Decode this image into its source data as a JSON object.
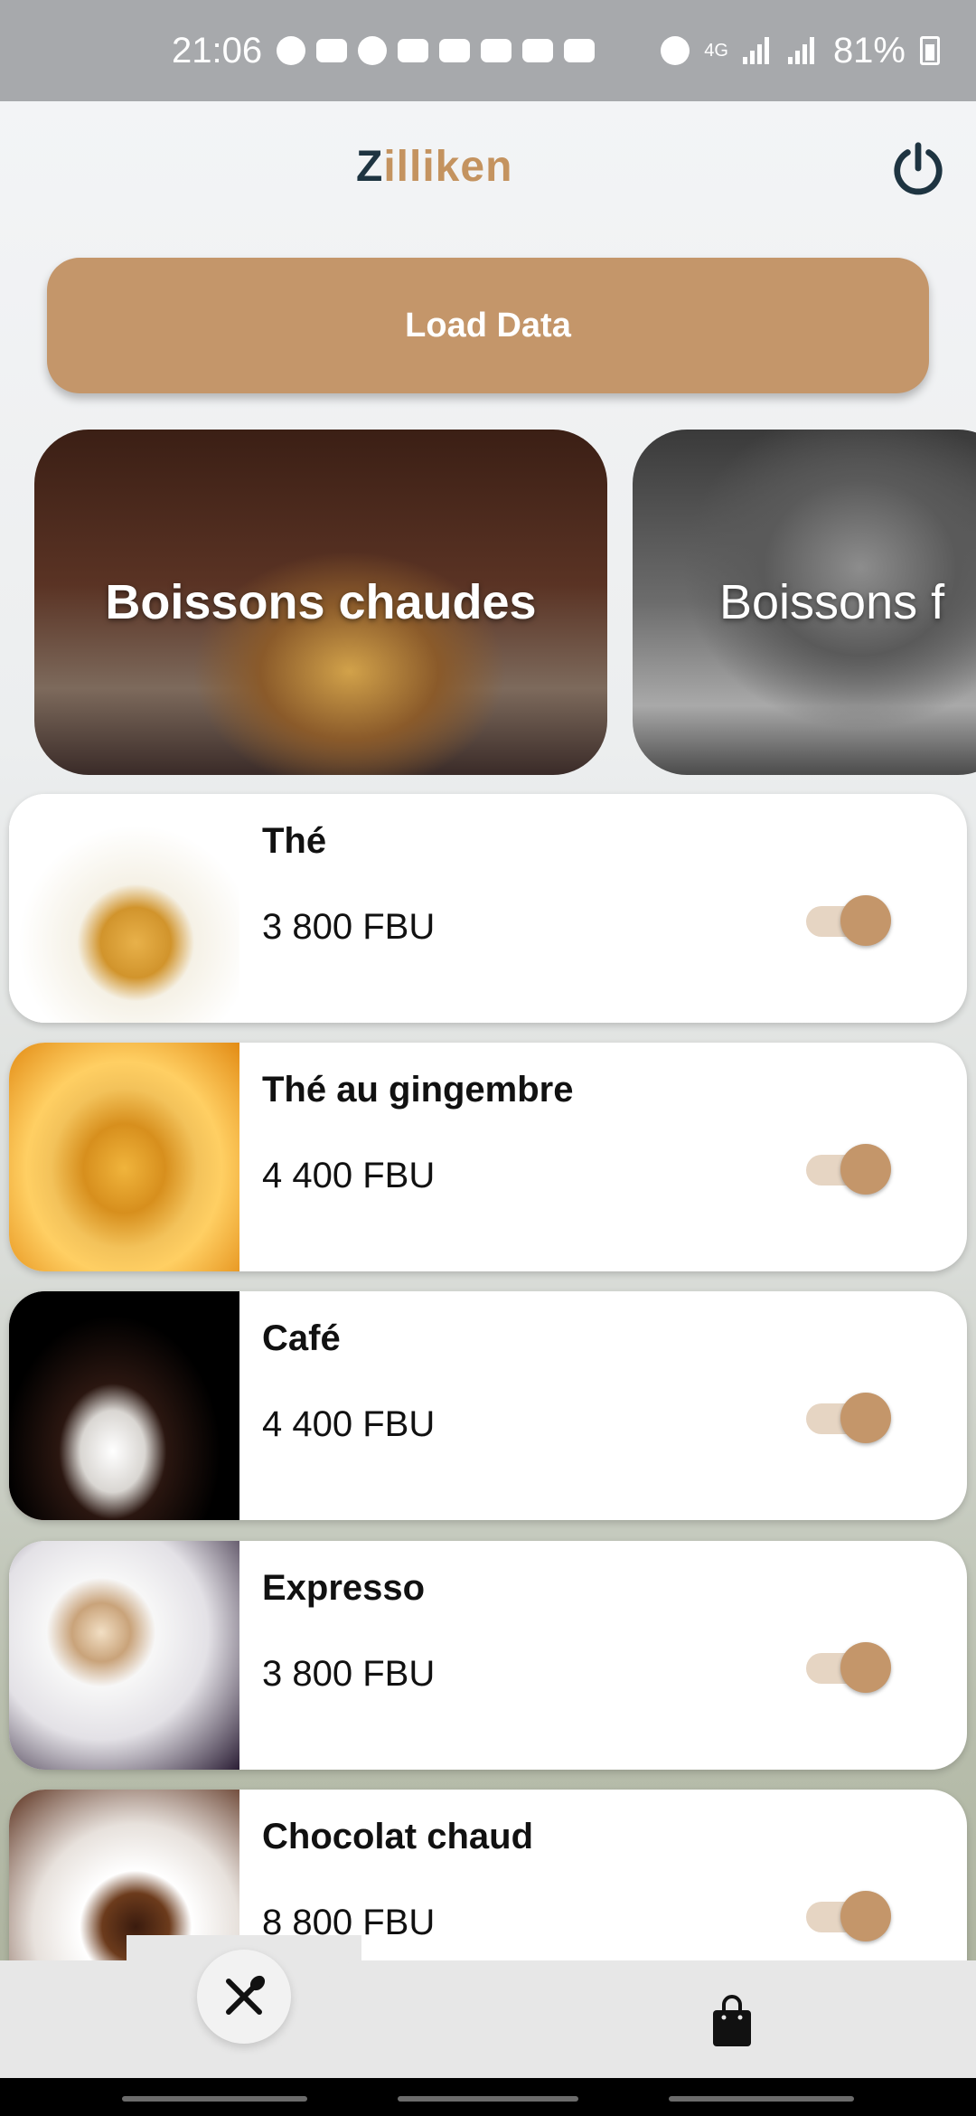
{
  "status_bar": {
    "time": "21:06",
    "battery": "81%",
    "network": "4G"
  },
  "app": {
    "brand_first": "Z",
    "brand_rest": "illiken"
  },
  "actions": {
    "load_label": "Load Data"
  },
  "categories": [
    {
      "label": "Boissons chaudes"
    },
    {
      "label": "Boissons f"
    }
  ],
  "items": [
    {
      "name": "Thé",
      "price": "3 800 FBU",
      "enabled": true
    },
    {
      "name": "Thé au gingembre",
      "price": "4 400 FBU",
      "enabled": true
    },
    {
      "name": "Café",
      "price": "4 400 FBU",
      "enabled": true
    },
    {
      "name": "Expresso",
      "price": "3 800 FBU",
      "enabled": true
    },
    {
      "name": "Chocolat chaud",
      "price": "8 800 FBU",
      "enabled": true
    }
  ],
  "colors": {
    "accent": "#c4966a",
    "brand_dark": "#1e3441"
  },
  "icons": {
    "power": "power-icon",
    "menu": "utensils-icon",
    "cart": "shopping-bag-icon"
  }
}
